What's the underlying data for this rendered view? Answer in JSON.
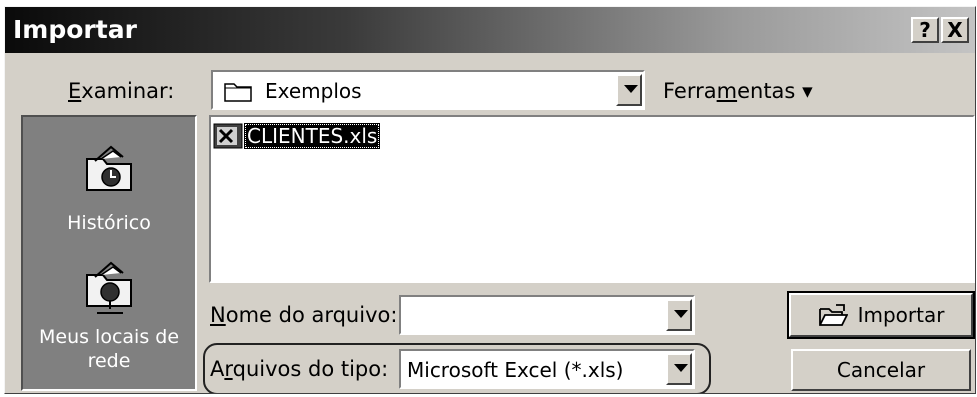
{
  "window": {
    "title": "Importar",
    "help_label": "?",
    "close_label": "X"
  },
  "toolbar": {
    "look_in_label_pre": "",
    "look_in_label_u": "E",
    "look_in_label_post": "xaminar:",
    "look_in_value": "Exemplos",
    "tools_label_pre": "Ferra",
    "tools_label_u": "m",
    "tools_label_post": "entas",
    "tools_caret": "▾"
  },
  "places": [
    {
      "label": "Histórico",
      "icon": "history-icon"
    },
    {
      "label_line1": "Meus locais de",
      "label_line2": "rede",
      "icon": "network-places-icon"
    }
  ],
  "files": [
    {
      "name": "CLIENTES.xls",
      "icon": "excel-file-icon",
      "selected": true
    }
  ],
  "filename": {
    "label_pre": "",
    "label_u": "N",
    "label_post": "ome do arquivo:",
    "value": ""
  },
  "filetype": {
    "label_pre": "A",
    "label_u": "r",
    "label_post": "quivos do tipo:",
    "value": "Microsoft Excel (*.xls)"
  },
  "buttons": {
    "import_label": "Importar",
    "cancel_label": "Cancelar"
  },
  "colors": {
    "titlebar_start": "#0a0a0a",
    "titlebar_end": "#c4c4c4",
    "dialog_bg": "#d4d0c8",
    "places_bg": "#808080",
    "selection_bg": "#000000"
  }
}
